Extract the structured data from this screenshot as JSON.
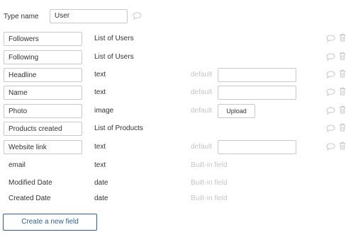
{
  "type_name": {
    "label": "Type name",
    "value": "User"
  },
  "fields": [
    {
      "name": "Followers",
      "type": "List of Users",
      "editable": true
    },
    {
      "name": "Following",
      "type": "List of Users",
      "editable": true
    },
    {
      "name": "Headline",
      "type": "text",
      "editable": true,
      "default_label": "default"
    },
    {
      "name": "Name",
      "type": "text",
      "editable": true,
      "default_label": "default"
    },
    {
      "name": "Photo",
      "type": "image",
      "editable": true,
      "default_label": "default",
      "upload_label": "Upload"
    },
    {
      "name": "Products created",
      "type": "List of Products",
      "editable": true
    },
    {
      "name": "Website link",
      "type": "text",
      "editable": true,
      "default_label": "default"
    },
    {
      "name": "email",
      "type": "text",
      "builtin_label": "Built-in field"
    },
    {
      "name": "Modified Date",
      "type": "date",
      "builtin_label": "Built-in field"
    },
    {
      "name": "Created Date",
      "type": "date",
      "builtin_label": "Built-in field"
    }
  ],
  "actions": {
    "create_label": "Create a new field"
  },
  "icons": {
    "comment": "comment-icon",
    "delete": "trash-icon"
  },
  "colors": {
    "accent": "#2f5f9a",
    "muted": "#c6c6c6",
    "border": "#c9c9c9",
    "icon": "#c8c8c8"
  }
}
